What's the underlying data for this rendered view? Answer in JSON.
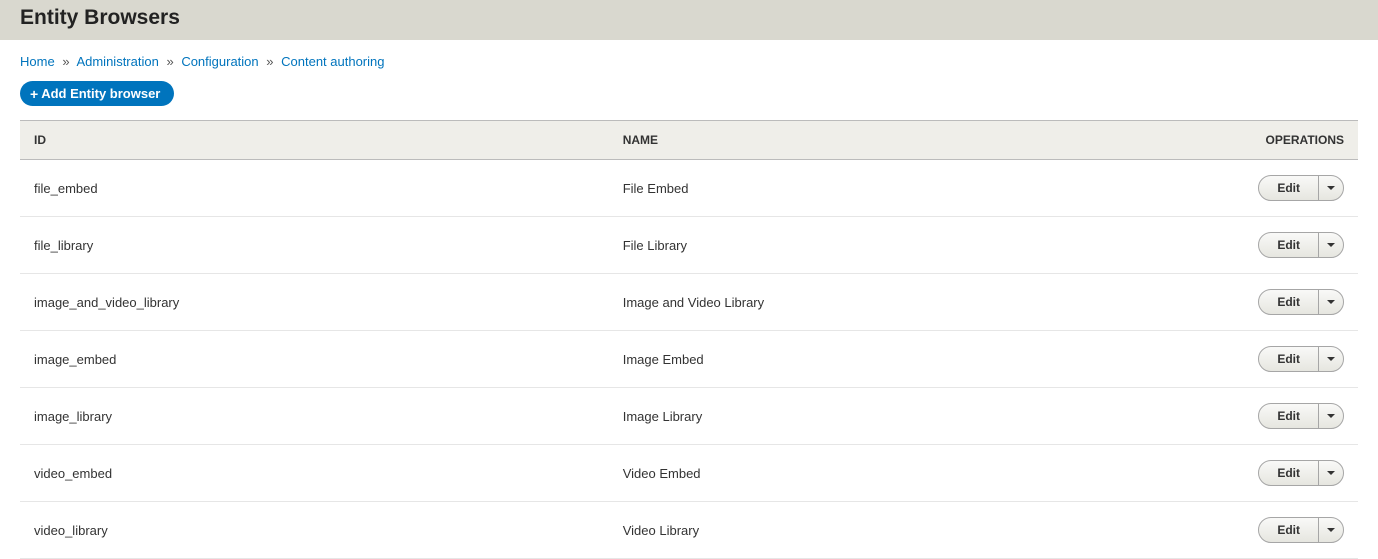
{
  "header": {
    "title": "Entity Browsers"
  },
  "breadcrumb": {
    "items": [
      {
        "label": "Home"
      },
      {
        "label": "Administration"
      },
      {
        "label": "Configuration"
      },
      {
        "label": "Content authoring"
      }
    ],
    "separator": "»"
  },
  "actions": {
    "add_label": "Add Entity browser"
  },
  "table": {
    "columns": {
      "id": "ID",
      "name": "NAME",
      "operations": "OPERATIONS"
    },
    "edit_label": "Edit",
    "rows": [
      {
        "id": "file_embed",
        "name": "File Embed"
      },
      {
        "id": "file_library",
        "name": "File Library"
      },
      {
        "id": "image_and_video_library",
        "name": "Image and Video Library"
      },
      {
        "id": "image_embed",
        "name": "Image Embed"
      },
      {
        "id": "image_library",
        "name": "Image Library"
      },
      {
        "id": "video_embed",
        "name": "Video Embed"
      },
      {
        "id": "video_library",
        "name": "Video Library"
      }
    ]
  }
}
